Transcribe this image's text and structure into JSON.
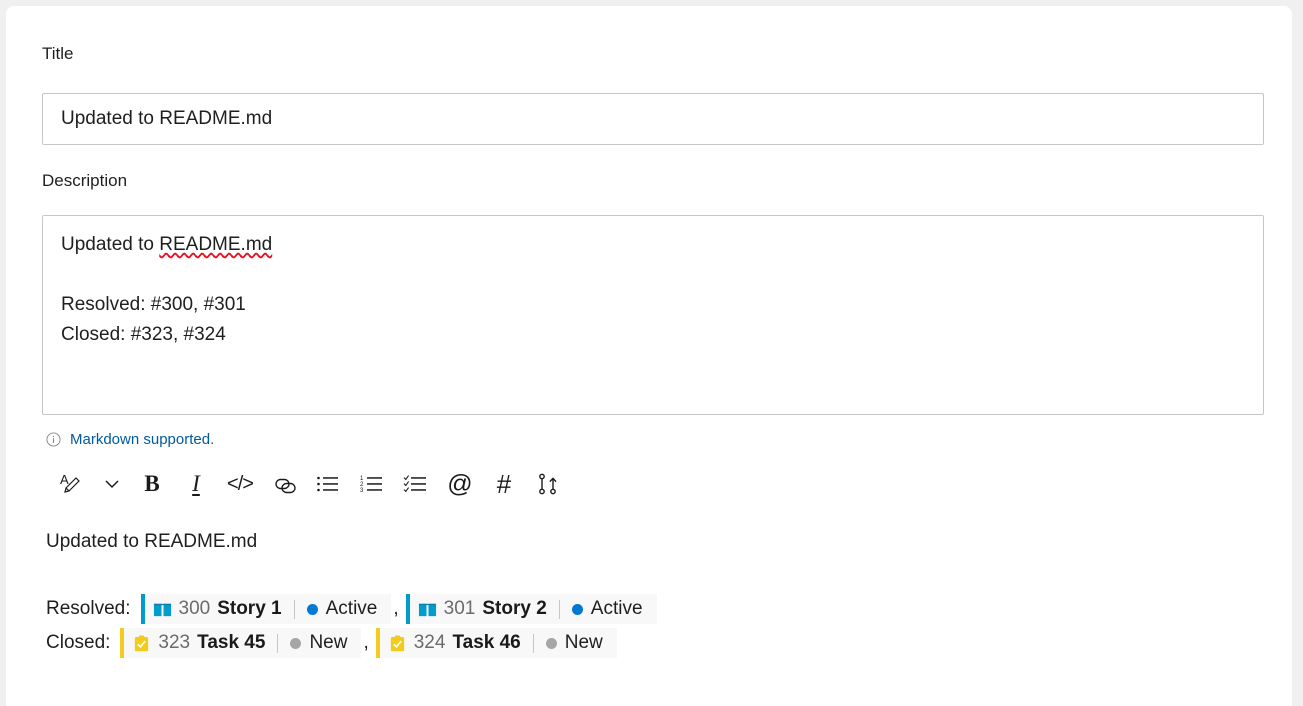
{
  "form": {
    "title_label": "Title",
    "title_value": "Updated to README.md",
    "description_label": "Description",
    "description_lines": [
      "Updated to README.md",
      "",
      "Resolved: #300, #301",
      "Closed: #323, #324"
    ],
    "description_line1_plain": "Updated to ",
    "description_line1_spellerror": "README.md",
    "description_line3": "Resolved: #300, #301",
    "description_line4": "Closed: #323, #324"
  },
  "markdown_note": {
    "icon": "info-circle-icon",
    "text": "Markdown supported."
  },
  "toolbar": {
    "items": [
      {
        "name": "font-color-icon",
        "glyph": "A"
      },
      {
        "name": "chevron-down-icon",
        "glyph": "⌄"
      },
      {
        "name": "bold-icon",
        "glyph": "B"
      },
      {
        "name": "italic-icon",
        "glyph": "I"
      },
      {
        "name": "code-icon",
        "glyph": "</>"
      },
      {
        "name": "link-icon",
        "glyph": "link"
      },
      {
        "name": "bulleted-list-icon",
        "glyph": "list"
      },
      {
        "name": "numbered-list-icon",
        "glyph": "123"
      },
      {
        "name": "checklist-icon",
        "glyph": "check-list"
      },
      {
        "name": "mention-icon",
        "glyph": "@"
      },
      {
        "name": "hashtag-icon",
        "glyph": "#"
      },
      {
        "name": "pull-request-icon",
        "glyph": "branch"
      }
    ]
  },
  "preview": {
    "heading": "Updated to README.md",
    "rows": [
      {
        "label": "Resolved:",
        "chips": [
          {
            "id": "300",
            "title": "Story 1",
            "state": "Active",
            "type": "User Story",
            "icon": "book-icon",
            "accent_color": "#009ccc",
            "state_color": "#0078d4"
          },
          {
            "id": "301",
            "title": "Story 2",
            "state": "Active",
            "type": "User Story",
            "icon": "book-icon",
            "accent_color": "#009ccc",
            "state_color": "#0078d4"
          }
        ]
      },
      {
        "label": "Closed:",
        "chips": [
          {
            "id": "323",
            "title": "Task 45",
            "state": "New",
            "type": "Task",
            "icon": "clipboard-check-icon",
            "accent_color": "#f2cb1d",
            "state_color": "#a6a6a6"
          },
          {
            "id": "324",
            "title": "Task 46",
            "state": "New",
            "type": "Task",
            "icon": "clipboard-check-icon",
            "accent_color": "#f2cb1d",
            "state_color": "#a6a6a6"
          }
        ]
      }
    ],
    "separator": ","
  },
  "colors": {
    "link": "#005a9e",
    "border": "#c8c6c4",
    "chip_bg": "#f8f8f8",
    "story_blue": "#009ccc",
    "task_yellow": "#f2cb1d",
    "active_dot": "#0078d4",
    "new_dot": "#a6a6a6",
    "spell_error": "#e81123"
  }
}
